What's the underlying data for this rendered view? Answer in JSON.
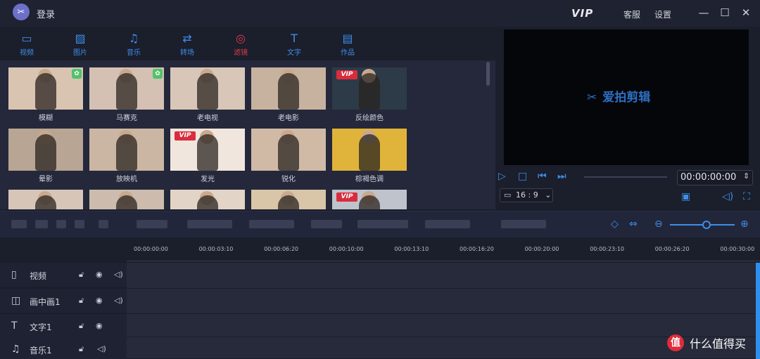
{
  "titlebar": {
    "login_label": "登录",
    "vip_label": "VIP",
    "service_label": "客服",
    "settings_label": "设置",
    "minimize": "—",
    "maximize": "☐",
    "close": "✕"
  },
  "tabs": [
    {
      "label": "视频",
      "icon": "film-icon"
    },
    {
      "label": "图片",
      "icon": "image-icon"
    },
    {
      "label": "音乐",
      "icon": "music-icon"
    },
    {
      "label": "转场",
      "icon": "transition-icon"
    },
    {
      "label": "滤镜",
      "icon": "filter-icon",
      "active": true
    },
    {
      "label": "文字",
      "icon": "text-icon"
    },
    {
      "label": "作品",
      "icon": "folder-icon"
    }
  ],
  "filters": [
    {
      "label": "模糊",
      "badge": "green",
      "bg": "#d9c4b2"
    },
    {
      "label": "马赛克",
      "badge": "green",
      "bg": "#d4c1b3"
    },
    {
      "label": "老电视",
      "badge": "",
      "bg": "#d8c7b8"
    },
    {
      "label": "老电影",
      "badge": "",
      "bg": "#c6b29f"
    },
    {
      "label": "反绘颜色",
      "badge": "VIP",
      "bg": "#2c3b47"
    },
    {
      "label": "晕影",
      "badge": "",
      "bg": "#b9a594"
    },
    {
      "label": "放映机",
      "badge": "",
      "bg": "#cbb6a4"
    },
    {
      "label": "发光",
      "badge": "VIP",
      "bg": "#f1e6dd"
    },
    {
      "label": "锐化",
      "badge": "",
      "bg": "#d0baa6"
    },
    {
      "label": "棕褐色调",
      "badge": "",
      "bg": "#e0b33a"
    },
    {
      "label": "",
      "badge": "",
      "bg": "#d7c6b8"
    },
    {
      "label": "",
      "badge": "",
      "bg": "#cdbcad"
    },
    {
      "label": "",
      "badge": "",
      "bg": "#e2d4c6"
    },
    {
      "label": "",
      "badge": "",
      "bg": "#d9c5a8"
    },
    {
      "label": "",
      "badge": "VIP",
      "bg": "#bfc4cc"
    }
  ],
  "preview": {
    "logo_text": "爱拍剪辑",
    "timecode": "00:00:00:00",
    "ratio": "16 : 9"
  },
  "ruler": [
    "00:00:00:00",
    "00:00:03:10",
    "00:00:06:20",
    "00:00:10:00",
    "00:00:13:10",
    "00:00:16:20",
    "00:00:20:00",
    "00:00:23:10",
    "00:00:26:20",
    "00:00:30:00"
  ],
  "tracks": [
    {
      "name": "视频",
      "icon": "film-icon",
      "glyph": "▯",
      "lock": true,
      "eye": true,
      "audio": true
    },
    {
      "name": "画中画1",
      "icon": "pip-icon",
      "glyph": "◫",
      "lock": true,
      "eye": true,
      "audio": true
    },
    {
      "name": "文字1",
      "icon": "text-icon",
      "glyph": "T",
      "lock": true,
      "eye": true,
      "audio": false
    },
    {
      "name": "音乐1",
      "icon": "music-icon",
      "glyph": "♫",
      "lock": true,
      "eye": false,
      "audio": true
    }
  ],
  "watermark": {
    "glyph": "值",
    "text": "什么值得买"
  }
}
